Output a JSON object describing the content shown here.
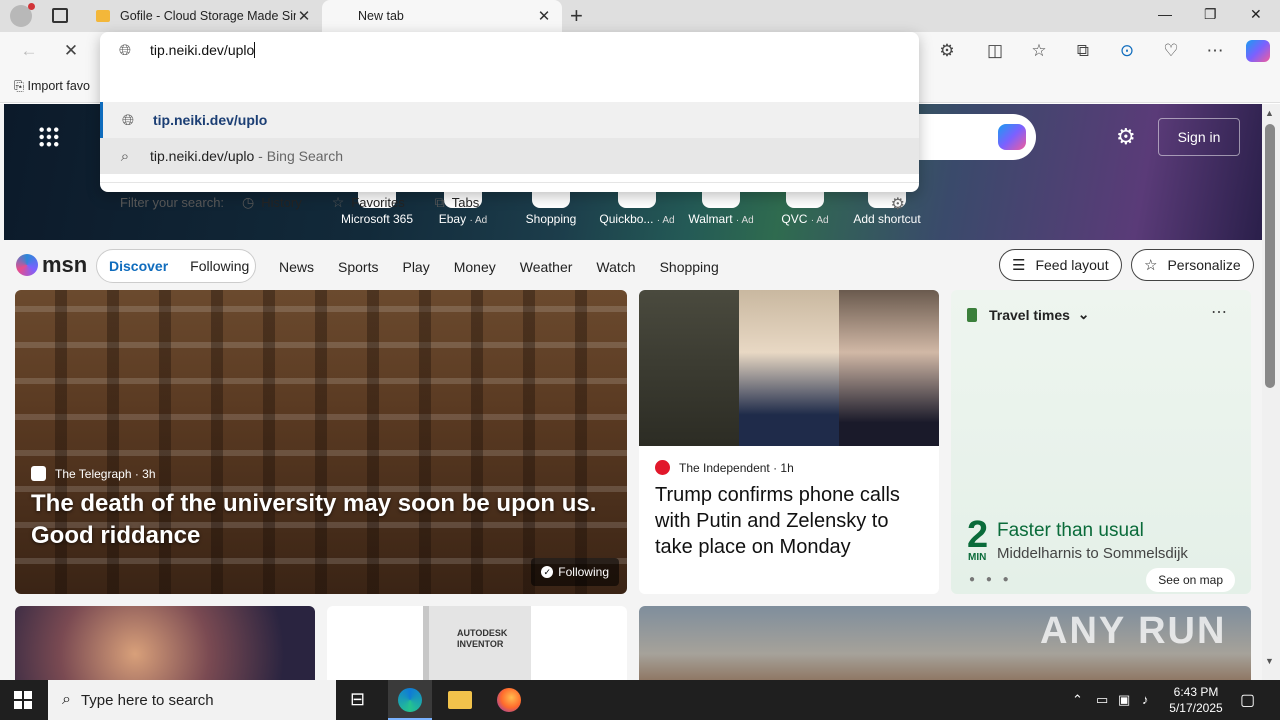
{
  "tabs": [
    {
      "title": "Gofile - Cloud Storage Made Simple",
      "active": false
    },
    {
      "title": "New tab",
      "active": true
    }
  ],
  "window_controls": {
    "minimize": "—",
    "maximize": "❐",
    "close": "✕"
  },
  "omnibox": {
    "value": "tip.neiki.dev/uplo",
    "suggestions": [
      {
        "text": "tip.neiki.dev/uplo",
        "suffix": ""
      },
      {
        "text": "tip.neiki.dev/uplo",
        "suffix": " - Bing Search"
      }
    ],
    "filter_label": "Filter your search:",
    "filters": [
      "History",
      "Favorites",
      "Tabs"
    ]
  },
  "favorites_bar": {
    "import_label": "Import favo"
  },
  "newtab": {
    "sign_in": "Sign in",
    "shortcuts": [
      {
        "label": "Microsoft 365",
        "ad": ""
      },
      {
        "label": "Ebay",
        "ad": "· Ad"
      },
      {
        "label": "Shopping",
        "ad": ""
      },
      {
        "label": "Quickbo...",
        "ad": "· Ad"
      },
      {
        "label": "Walmart",
        "ad": "· Ad"
      },
      {
        "label": "QVC",
        "ad": "· Ad"
      },
      {
        "label": "Add shortcut",
        "ad": ""
      }
    ]
  },
  "msn": {
    "logo": "msn",
    "pill": {
      "discover": "Discover",
      "following": "Following"
    },
    "nav": [
      "News",
      "Sports",
      "Play",
      "Money",
      "Weather",
      "Watch",
      "Shopping"
    ],
    "feed_layout": "Feed layout",
    "personalize": "Personalize"
  },
  "cards": {
    "main": {
      "source": "The Telegraph · 3h",
      "headline": "The death of the university may soon be upon us. Good riddance",
      "following": "Following"
    },
    "news": {
      "source": "The Independent · 1h",
      "headline": "Trump confirms phone calls with Putin and Zelensky to take place on Monday"
    },
    "travel": {
      "title": "Travel times",
      "minutes": "2",
      "unit": "MIN",
      "status": "Faster than usual",
      "route": "Middelharnis to Sommelsdijk",
      "see_map": "See on map"
    },
    "autodesk": {
      "label": "AUTODESK INVENTOR"
    }
  },
  "watermark": "ANY RUN",
  "taskbar": {
    "search_placeholder": "Type here to search",
    "time": "6:43 PM",
    "date": "5/17/2025"
  }
}
